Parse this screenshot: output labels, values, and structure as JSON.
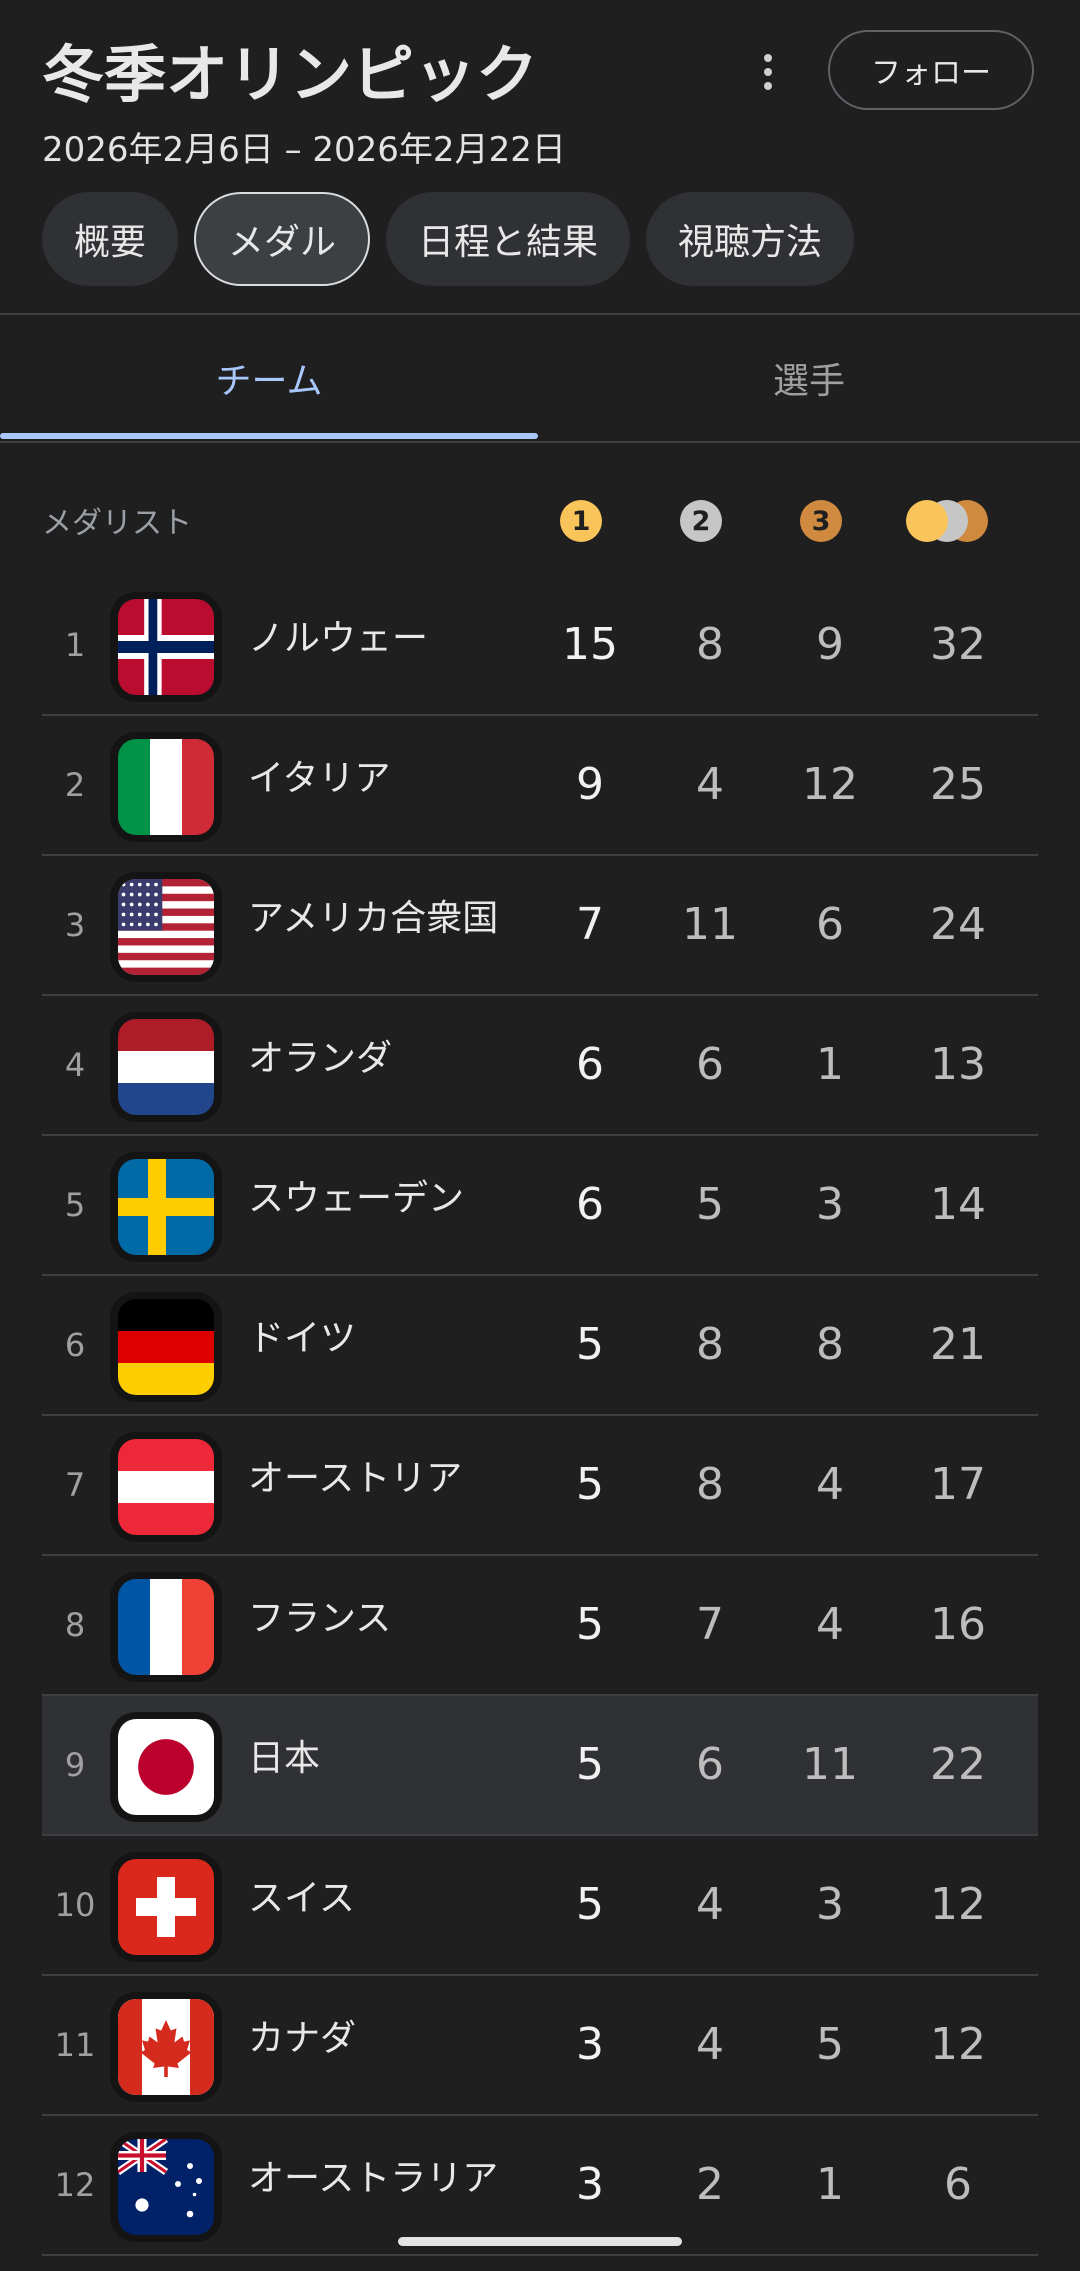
{
  "header": {
    "title": "冬季オリンピック",
    "dates": "2026年2月6日 – 2026年2月22日",
    "follow_label": "フォロー",
    "chips": [
      "概要",
      "メダル",
      "日程と結果",
      "視聴方法"
    ],
    "active_chip": "メダル"
  },
  "tabs": {
    "team": "チーム",
    "player": "選手",
    "active": "チーム"
  },
  "table": {
    "medalist_label": "メダリスト",
    "gold_icon": "1",
    "silver_icon": "2",
    "bronze_icon": "3",
    "rows": [
      {
        "rank": "1",
        "country": "ノルウェー",
        "flag": "norway-flag",
        "gold": "15",
        "silver": "8",
        "bronze": "9",
        "total": "32"
      },
      {
        "rank": "2",
        "country": "イタリア",
        "flag": "italy-flag",
        "gold": "9",
        "silver": "4",
        "bronze": "12",
        "total": "25"
      },
      {
        "rank": "3",
        "country": "アメリカ合衆国",
        "flag": "usa-flag",
        "gold": "7",
        "silver": "11",
        "bronze": "6",
        "total": "24"
      },
      {
        "rank": "4",
        "country": "オランダ",
        "flag": "netherlands-flag",
        "gold": "6",
        "silver": "6",
        "bronze": "1",
        "total": "13"
      },
      {
        "rank": "5",
        "country": "スウェーデン",
        "flag": "sweden-flag",
        "gold": "6",
        "silver": "5",
        "bronze": "3",
        "total": "14"
      },
      {
        "rank": "6",
        "country": "ドイツ",
        "flag": "germany-flag",
        "gold": "5",
        "silver": "8",
        "bronze": "8",
        "total": "21"
      },
      {
        "rank": "7",
        "country": "オーストリア",
        "flag": "austria-flag",
        "gold": "5",
        "silver": "8",
        "bronze": "4",
        "total": "17"
      },
      {
        "rank": "8",
        "country": "フランス",
        "flag": "france-flag",
        "gold": "5",
        "silver": "7",
        "bronze": "4",
        "total": "16"
      },
      {
        "rank": "9",
        "country": "日本",
        "flag": "japan-flag",
        "gold": "5",
        "silver": "6",
        "bronze": "11",
        "total": "22",
        "highlighted": true
      },
      {
        "rank": "10",
        "country": "スイス",
        "flag": "switzerland-flag",
        "gold": "5",
        "silver": "4",
        "bronze": "3",
        "total": "12"
      },
      {
        "rank": "11",
        "country": "カナダ",
        "flag": "canada-flag",
        "gold": "3",
        "silver": "4",
        "bronze": "5",
        "total": "12"
      },
      {
        "rank": "12",
        "country": "オーストラリア",
        "flag": "australia-flag",
        "gold": "3",
        "silver": "2",
        "bronze": "1",
        "total": "6"
      }
    ]
  },
  "colors": {
    "accent": "#a8c7fa",
    "gold": "#f9c55a",
    "silver": "#c6c6c6",
    "bronze": "#cf8a3f",
    "background": "#1f1f1f"
  }
}
